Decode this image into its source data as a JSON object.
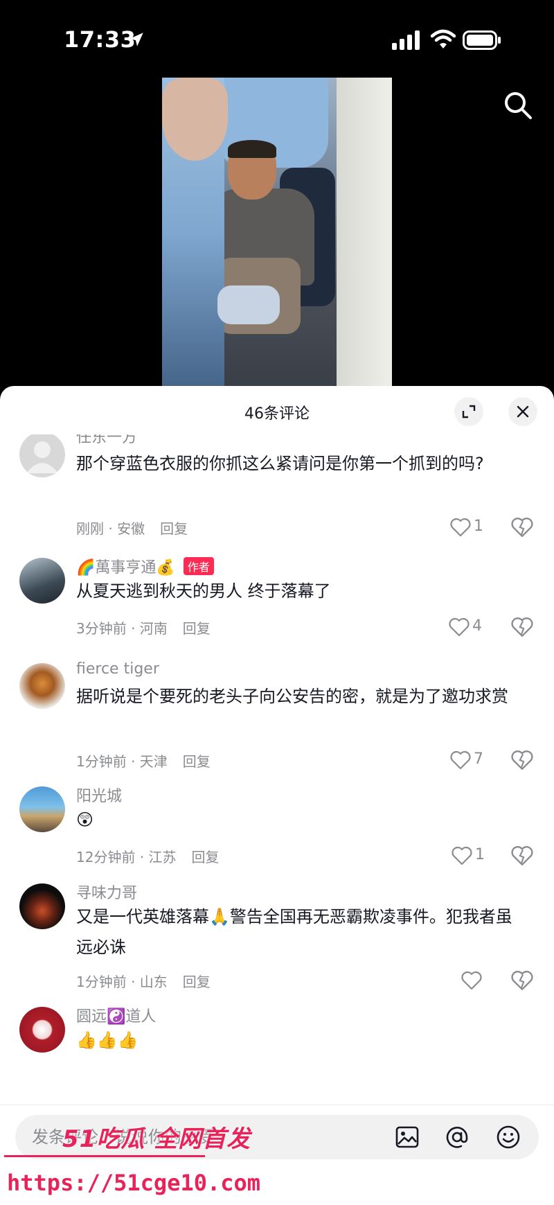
{
  "status_bar": {
    "time": "17:33"
  },
  "sheet": {
    "title": "46条评论"
  },
  "comments": [
    {
      "name": "任东一方",
      "text": "那个穿蓝色衣服的你抓这么紧请问是你第一个抓到的吗?",
      "meta": "刚刚 · 安徽",
      "reply": "回复",
      "likes": "1"
    },
    {
      "name": "🌈萬事亨通💰",
      "author_badge": "作者",
      "text": "从夏天逃到秋天的男人  终于落幕了",
      "meta": "3分钟前 · 河南",
      "reply": "回复",
      "likes": "4"
    },
    {
      "name": "fierce     tiger",
      "text": "据听说是个要死的老头子向公安告的密，就是为了邀功求赏",
      "meta": "1分钟前 · 天津",
      "reply": "回复",
      "likes": "7"
    },
    {
      "name": "阳光城",
      "text": "😲",
      "meta": "12分钟前 · 江苏",
      "reply": "回复",
      "likes": "1"
    },
    {
      "name": "寻味力哥",
      "text": "又是一代英雄落幕🙏警告全国再无恶霸欺凌事件。犯我者虽远必诛",
      "meta": "1分钟前 · 山东",
      "reply": "回复",
      "likes": ""
    },
    {
      "name": "圆远☯️道人",
      "text": "👍👍👍",
      "meta": "",
      "reply": "",
      "likes": ""
    }
  ],
  "input": {
    "placeholder": "发条评论，说说你的感受"
  },
  "watermark": {
    "logo": "51吃瓜 全网首发",
    "url": "https://51cge10.com"
  }
}
